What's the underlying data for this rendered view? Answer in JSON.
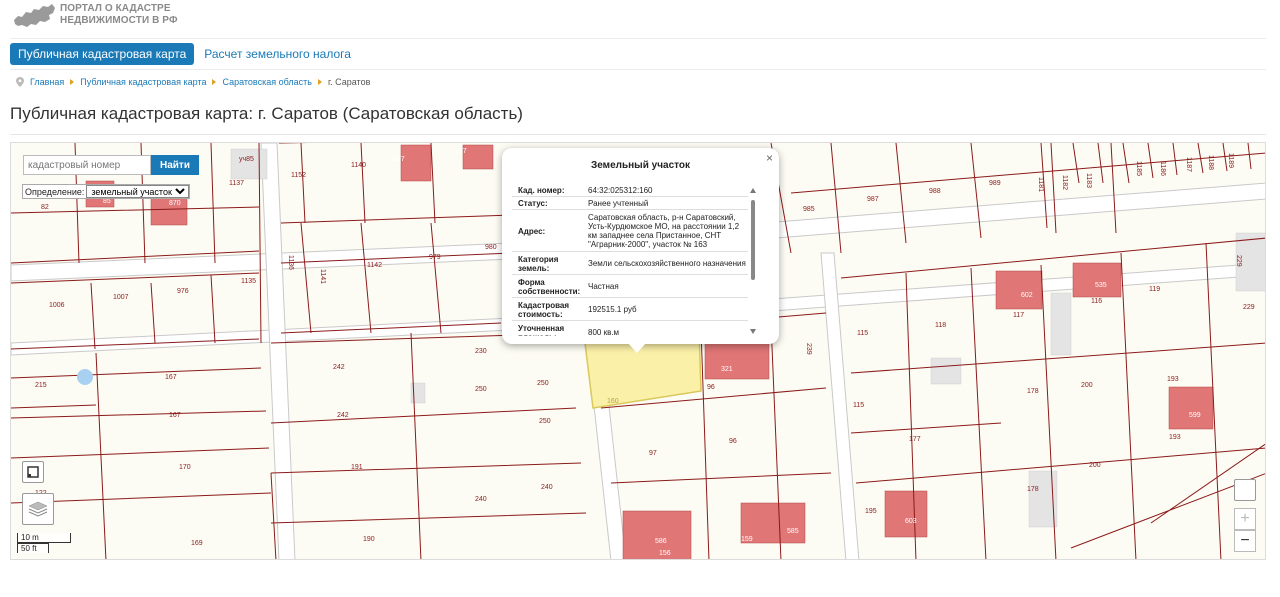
{
  "header": {
    "logo_line1": "Портал о кадастре",
    "logo_line2": "недвижимости в РФ"
  },
  "tabs": [
    {
      "label": "Публичная кадастровая карта",
      "active": true
    },
    {
      "label": "Расчет земельного налога",
      "active": false
    }
  ],
  "breadcrumb": [
    "Главная",
    "Публичная кадастровая карта",
    "Саратовская область",
    "г. Саратов"
  ],
  "page_title": "Публичная кадастровая карта: г. Саратов (Саратовская область)",
  "search": {
    "placeholder": "кадастровый номер",
    "button_label": "Найти",
    "definition_label": "Определение:",
    "definition_value": "земельный участок"
  },
  "popup": {
    "title": "Земельный участок",
    "close": "×",
    "rows": [
      {
        "key": "Кад. номер:",
        "value": "64:32:025312:160"
      },
      {
        "key": "Статус:",
        "value": "Ранее учтенный"
      },
      {
        "key": "Адрес:",
        "value": "Саратовская область, р-н Саратовский, Усть-Курдюмское МО, на расстоянии 1,2 км западнее села Пристанное, СНТ \"Аграрник-2000\", участок № 163"
      },
      {
        "key": "Категория земель:",
        "value": "Земли сельскохозяйственного назначения"
      },
      {
        "key": "Форма собственности:",
        "value": "Частная"
      },
      {
        "key": "Кадастровая стоимость:",
        "value": "192515.1 руб"
      },
      {
        "key": "Уточненная площадь:",
        "value": "800 кв.м"
      }
    ]
  },
  "map": {
    "selected_parcel_label": "160",
    "scale_metric": "10 m",
    "scale_imperial": "50 ft",
    "zoom_in": "+",
    "zoom_out": "−",
    "parcel_labels": [
      "уч85",
      "1137",
      "1152",
      "1140",
      "927",
      "937",
      "82",
      "870",
      "85",
      "1006",
      "1007",
      "976",
      "1135",
      "1136",
      "1141",
      "1142",
      "979",
      "980",
      "985",
      "987",
      "988",
      "989",
      "1181",
      "1182",
      "1183",
      "1185",
      "1186",
      "1187",
      "1188",
      "1189",
      "229",
      "229",
      "602",
      "117",
      "535",
      "116",
      "119",
      "215",
      "167",
      "167",
      "170",
      "242",
      "242",
      "230",
      "250",
      "250",
      "250",
      "191",
      "240",
      "240",
      "122",
      "169",
      "190",
      "97",
      "96",
      "96",
      "321",
      "239",
      "115",
      "118",
      "115",
      "177",
      "178",
      "200",
      "193",
      "599",
      "193",
      "200",
      "178",
      "195",
      "603",
      "586",
      "156",
      "159",
      "585"
    ],
    "colors": {
      "parcel_line": "#8b1a1a",
      "building": "#e07676",
      "selected_fill": "#fbf0a8",
      "road": "#ffffff",
      "background": "#fdfcf4"
    }
  }
}
